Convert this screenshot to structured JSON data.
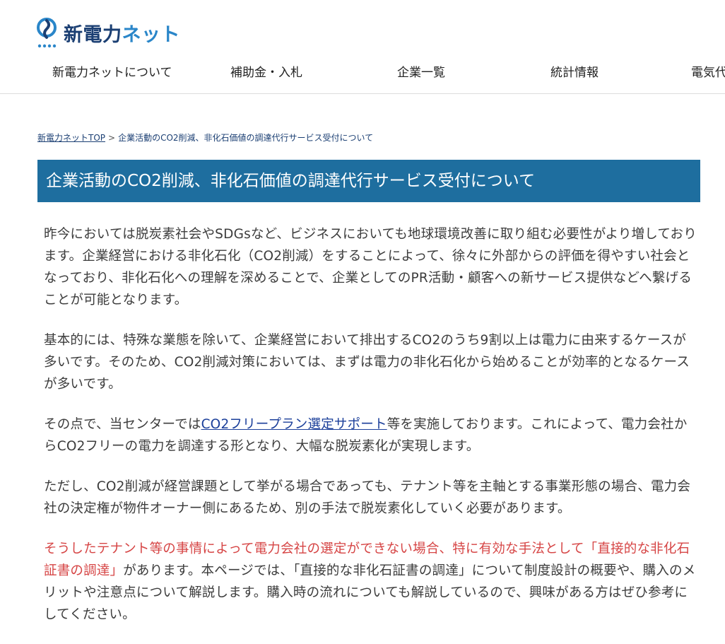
{
  "header": {
    "logo_text_kanji": "新電力",
    "logo_text_kana": "ネット"
  },
  "nav": {
    "items": [
      {
        "label": "新電力ネットについて"
      },
      {
        "label": "補助金・入札"
      },
      {
        "label": "企業一覧"
      },
      {
        "label": "統計情報"
      },
      {
        "label": "電気代"
      }
    ]
  },
  "breadcrumb": {
    "home": "新電力ネットTOP",
    "separator": ">",
    "current": "企業活動のCO2削減、非化石価値の調達代行サービス受付について"
  },
  "page": {
    "title": "企業活動のCO2削減、非化石価値の調達代行サービス受付について"
  },
  "content": {
    "p1": "昨今においては脱炭素社会やSDGsなど、ビジネスにおいても地球環境改善に取り組む必要性がより増しております。企業経営における非化石化（CO2削減）をすることによって、徐々に外部からの評価を得やすい社会となっており、非化石化への理解を深めることで、企業としてのPR活動・顧客への新サービス提供などへ繋げることが可能となります。",
    "p2": "基本的には、特殊な業態を除いて、企業経営において排出するCO2のうち9割以上は電力に由来するケースが多いです。そのため、CO2削減対策においては、まずは電力の非化石化から始めることが効率的となるケースが多いです。",
    "p3_before": "その点で、当センターでは",
    "p3_link": "CO2フリープラン選定サポート",
    "p3_after": "等を実施しております。これによって、電力会社からCO2フリーの電力を調達する形となり、大幅な脱炭素化が実現します。",
    "p4": "ただし、CO2削減が経営課題として挙がる場合であっても、テナント等を主軸とする事業形態の場合、電力会社の決定権が物件オーナー側にあるため、別の手法で脱炭素化していく必要があります。",
    "p5_red": "そうしたテナント等の事情によって電力会社の選定ができない場合、特に有効な手法として「直接的な非化石証書の調達」",
    "p5_rest": "があります。本ページでは、「直接的な非化石証書の調達」について制度設計の概要や、購入のメリットや注意点について解説します。購入時の流れについても解説しているので、興味がある方はぜひ参考にしてください。"
  },
  "colors": {
    "title_bar": "#1e6e9f",
    "accent_red": "#d64545",
    "logo_navy": "#1b3f73",
    "logo_blue": "#2a86c9"
  }
}
